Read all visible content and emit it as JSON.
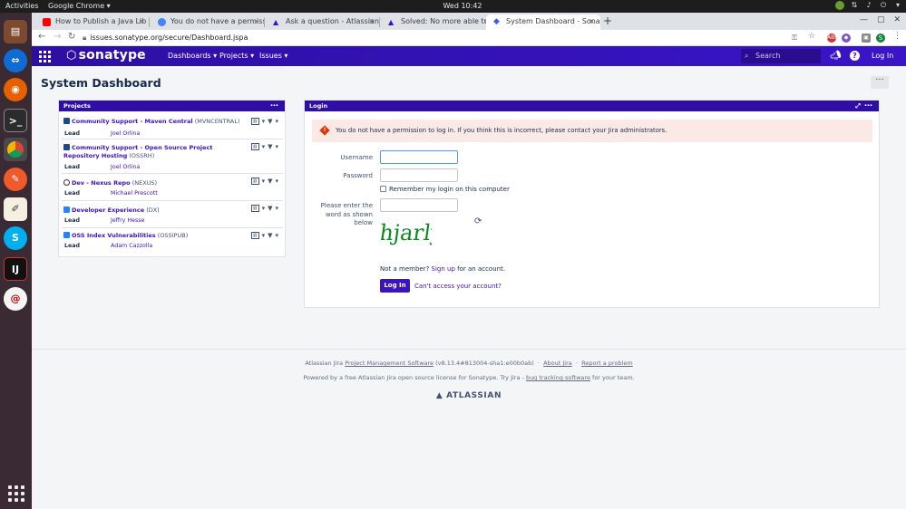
{
  "os": {
    "activities": "Activities",
    "app_name": "Google Chrome",
    "clock": "Wed 10:42"
  },
  "browser": {
    "tabs": [
      {
        "title": "How to Publish a Java Lib",
        "favicon_color": "#ff0000"
      },
      {
        "title": "You do not have a permiss",
        "favicon_color": "#4285f4"
      },
      {
        "title": "Ask a question - Atlassian",
        "favicon_color": "#3b13bf"
      },
      {
        "title": "Solved: No more able to lo",
        "favicon_color": "#3b13bf"
      },
      {
        "title": "System Dashboard - Sona",
        "favicon_color": "#3b5fe0"
      }
    ],
    "new_tab": "+",
    "url": "issues.sonatype.org/secure/Dashboard.jspa",
    "profile_initial": "S"
  },
  "header": {
    "logo": "sonatype",
    "menus": [
      "Dashboards",
      "Projects",
      "Issues"
    ],
    "search_placeholder": "Search",
    "login": "Log In"
  },
  "page": {
    "title": "System Dashboard",
    "more": "···"
  },
  "projects_gadget": {
    "title": "Projects",
    "lead_label": "Lead",
    "items": [
      {
        "name": "Community Support - Maven Central",
        "key": "(MVNCENTRAL)",
        "lead": "Joel Orlina"
      },
      {
        "name": "Community Support - Open Source Project Repository Hosting",
        "key": "(OSSRH)",
        "lead": "Joel Orlina"
      },
      {
        "name": "Dev - Nexus Repo",
        "key": "(NEXUS)",
        "lead": "Michael Prescott"
      },
      {
        "name": "Developer Experience",
        "key": "(DX)",
        "lead": "Jeffry Hesse"
      },
      {
        "name": "OSS Index Vulnerabilities",
        "key": "(OSSIPUB)",
        "lead": "Adam Cazzolla"
      }
    ]
  },
  "login_gadget": {
    "title": "Login",
    "error": "You do not have a permission to log in. If you think this is incorrect, please contact your Jira administrators.",
    "username_label": "Username",
    "password_label": "Password",
    "username_value": "",
    "password_value": "",
    "remember": "Remember my login on this computer",
    "captcha_label": "Please enter the word as shown below",
    "captcha_word": "hjarly",
    "not_member": "Not a member?",
    "sign_up": "Sign up",
    "for_account": "for an account.",
    "login_button": "Log In",
    "cant_access": "Can't access your account?"
  },
  "footer": {
    "line1_prefix": "Atlassian Jira",
    "line1_link": "Project Management Software",
    "line1_version": "(v8.13.4#813004-sha1:e00b0ab)",
    "about": "About Jira",
    "report": "Report a problem",
    "line2_prefix": "Powered by a free Atlassian",
    "line2_jira": "Jira",
    "line2_mid": "open source license for Sonatype. Try Jira -",
    "line2_link": "bug tracking software",
    "line2_suffix": "for your team.",
    "brand": "ATLASSIAN"
  }
}
